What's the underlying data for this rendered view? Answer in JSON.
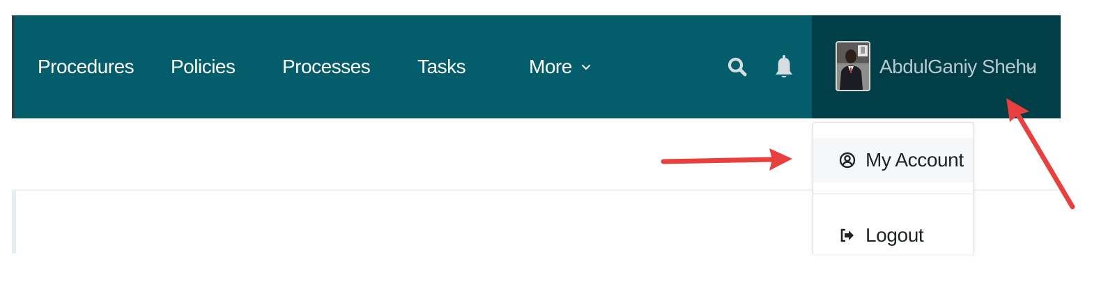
{
  "navbar": {
    "items": [
      {
        "label": "Procedures"
      },
      {
        "label": "Policies"
      },
      {
        "label": "Processes"
      },
      {
        "label": "Tasks"
      },
      {
        "label": "More"
      }
    ],
    "search_icon": "search-icon",
    "bell_icon": "bell-icon"
  },
  "user": {
    "name": "AbdulGaniy Shehu",
    "avatar_icon": "user-photo"
  },
  "dropdown": {
    "items": [
      {
        "label": "My Account",
        "icon": "user-circle-icon"
      },
      {
        "label": "Logout",
        "icon": "logout-icon"
      }
    ]
  },
  "colors": {
    "navbar": "#035d6a",
    "user_area": "#003f47",
    "annotation_arrow": "#e8403f"
  }
}
